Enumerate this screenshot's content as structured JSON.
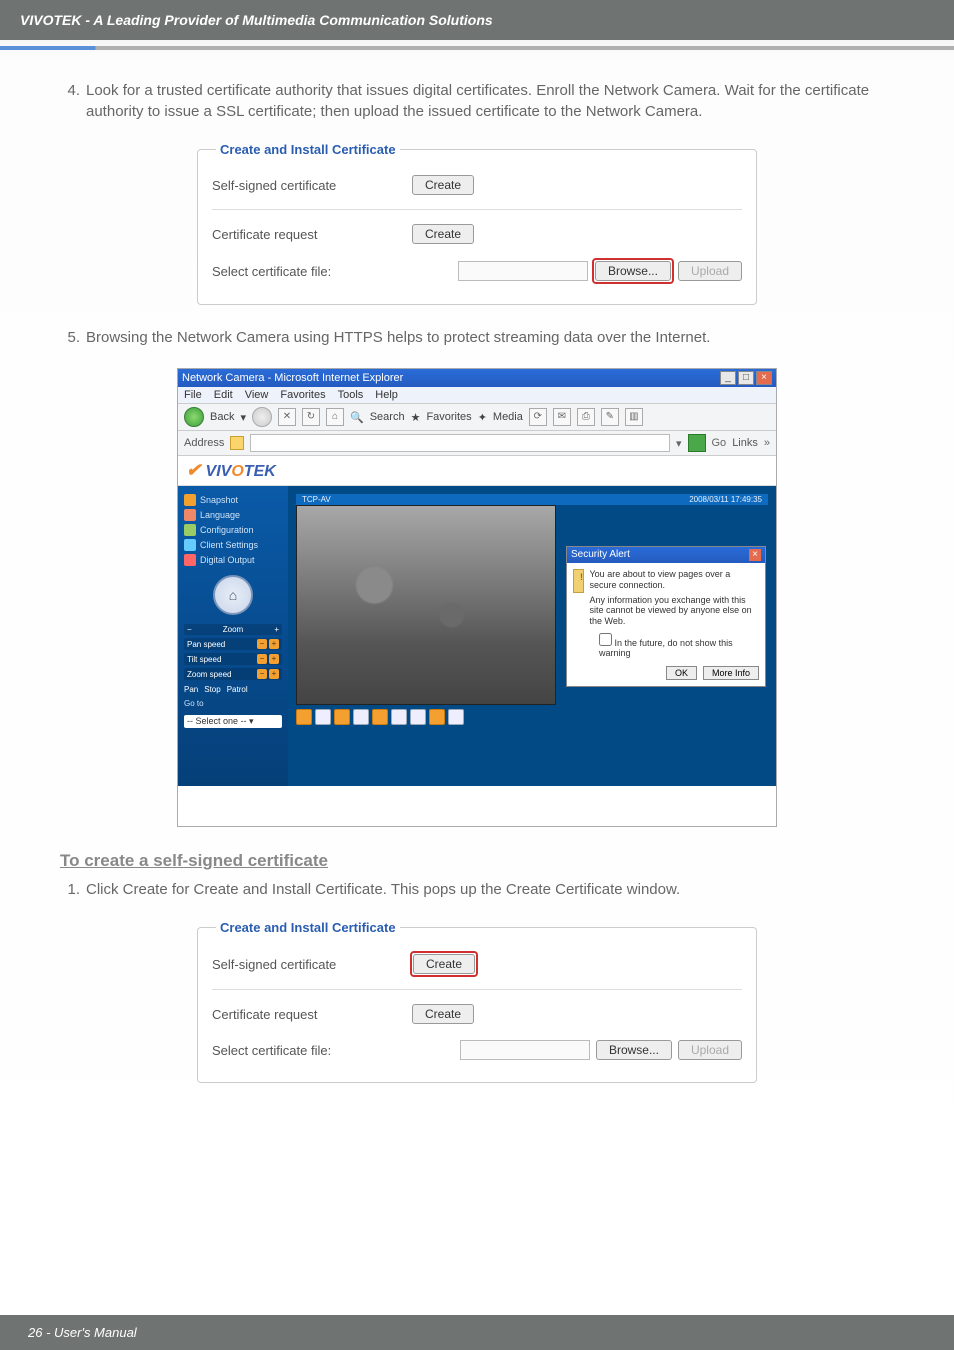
{
  "header": {
    "title": "VIVOTEK - A Leading Provider of Multimedia Communication Solutions"
  },
  "steps": {
    "s4": {
      "num": "4.",
      "text": "Look for a trusted certificate authority that issues digital certificates. Enroll the Network Camera. Wait for the certificate authority to issue a SSL certificate; then upload the issued certificate to the Network Camera."
    },
    "s5": {
      "num": "5.",
      "text": "Browsing the Network Camera using HTTPS helps to protect streaming data over the Internet."
    },
    "sub1": {
      "num": "1.",
      "text": "Click Create for Create and Install Certificate. This pops up the Create Certificate window."
    }
  },
  "section": {
    "self_signed_heading": "To create a self-signed certificate"
  },
  "cert_form": {
    "legend": "Create and Install Certificate",
    "self_signed_label": "Self-signed certificate",
    "cert_request_label": "Certificate request",
    "select_file_label": "Select certificate file:",
    "btn_create": "Create",
    "btn_browse": "Browse...",
    "btn_upload": "Upload"
  },
  "browser": {
    "title": "Network Camera - Microsoft Internet Explorer",
    "menu": [
      "File",
      "Edit",
      "View",
      "Favorites",
      "Tools",
      "Help"
    ],
    "toolbar": {
      "back": "Back",
      "search": "Search",
      "favorites": "Favorites",
      "media": "Media"
    },
    "addr": {
      "label": "Address",
      "go": "Go",
      "links": "Links"
    },
    "logo": {
      "pre": "VIV",
      "orange": "O",
      "post": "TEK"
    },
    "video_top": {
      "left": "TCP-AV",
      "right": "2008/03/11 17:49:35"
    },
    "sidebar": {
      "snapshot": "Snapshot",
      "language": "Language",
      "configuration": "Configuration",
      "client_settings": "Client Settings",
      "digital_output": "Digital Output",
      "zoom": "Zoom",
      "pan_speed": "Pan speed",
      "tilt_speed": "Tilt speed",
      "zoom_speed": "Zoom speed",
      "pan": "Pan",
      "stop": "Stop",
      "patrol": "Patrol",
      "goto": "Go to",
      "select": "-- Select one --"
    },
    "alert": {
      "title": "Security Alert",
      "line1": "You are about to view pages over a secure connection.",
      "line2": "Any information you exchange with this site cannot be viewed by anyone else on the Web.",
      "checkbox": "In the future, do not show this warning",
      "ok": "OK",
      "more": "More Info"
    }
  },
  "footer": {
    "text": "26 - User's Manual"
  }
}
